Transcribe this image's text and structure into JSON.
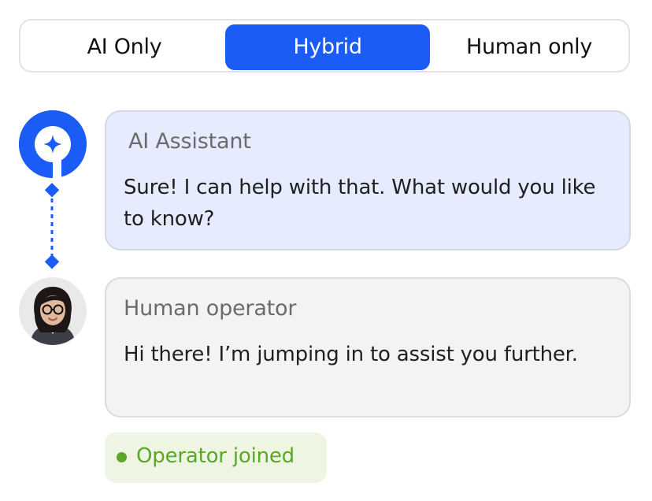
{
  "mode_selector": {
    "options": [
      "AI Only",
      "Hybrid",
      "Human only"
    ],
    "selected": "Hybrid"
  },
  "colors": {
    "accent": "#1a5cf5",
    "ai_bubble_bg": "#e6ecfe",
    "human_bubble_bg": "#f4f3f1",
    "status_green": "#5aa823"
  },
  "messages": [
    {
      "sender": "AI Assistant",
      "text": "Sure! I can help with that. What would you like to know?",
      "avatar_icon": "ai-assistant-logo-icon"
    },
    {
      "sender": "Human operator",
      "text": "Hi there! I’m jumping in to assist you further.",
      "avatar_icon": "human-operator-photo"
    }
  ],
  "status": {
    "text": "Operator joined"
  }
}
